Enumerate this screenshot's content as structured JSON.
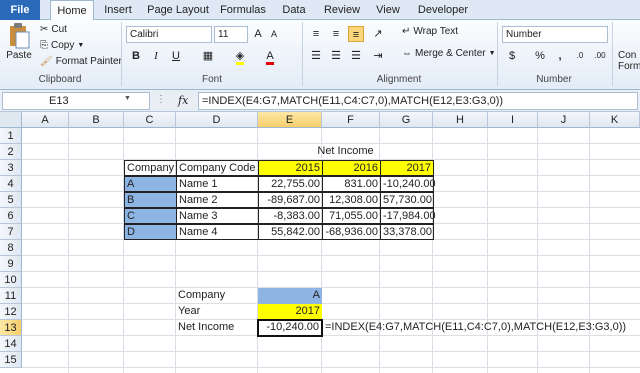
{
  "ribbon": {
    "tabs": [
      "File",
      "Home",
      "Insert",
      "Page Layout",
      "Formulas",
      "Data",
      "Review",
      "View",
      "Developer"
    ],
    "clipboard": {
      "paste": "Paste",
      "cut": "Cut",
      "copy": "Copy",
      "format_painter": "Format Painter",
      "group": "Clipboard"
    },
    "font": {
      "name": "Calibri",
      "size": "11",
      "bold": "B",
      "italic": "I",
      "underline": "U",
      "group": "Font"
    },
    "alignment": {
      "wrap": "Wrap Text",
      "merge": "Merge & Center",
      "group": "Alignment"
    },
    "number": {
      "format": "Number",
      "percent": "%",
      "comma": ",",
      "group": "Number"
    },
    "styles": {
      "cond": "Con",
      "form": "Form"
    }
  },
  "formula_bar": {
    "name_box": "E13",
    "fx": "fx",
    "formula": "=INDEX(E4:G7,MATCH(E11,C4:C7,0),MATCH(E12,E3:G3,0))"
  },
  "grid": {
    "columns": [
      "A",
      "B",
      "C",
      "D",
      "E",
      "F",
      "G",
      "H",
      "I",
      "J",
      "K"
    ],
    "rows": [
      "1",
      "2",
      "3",
      "4",
      "5",
      "6",
      "7",
      "8",
      "9",
      "10",
      "11",
      "12",
      "13",
      "14",
      "15"
    ],
    "title": "Net Income",
    "header": {
      "company": "Company",
      "code": "Company Code",
      "y2015": "2015",
      "y2016": "2016",
      "y2017": "2017"
    },
    "data": [
      {
        "company": "A",
        "code": "Name 1",
        "v2015": "22,755.00",
        "v2016": "831.00",
        "v2017": "-10,240.00"
      },
      {
        "company": "B",
        "code": "Name 2",
        "v2015": "-89,687.00",
        "v2016": "12,308.00",
        "v2017": "57,730.00"
      },
      {
        "company": "C",
        "code": "Name 3",
        "v2015": "-8,383.00",
        "v2016": "71,055.00",
        "v2017": "-17,984.00"
      },
      {
        "company": "D",
        "code": "Name 4",
        "v2015": "55,842.00",
        "v2016": "-68,936.00",
        "v2017": "33,378.00"
      }
    ],
    "lookup": {
      "company_label": "Company",
      "company_value": "A",
      "year_label": "Year",
      "year_value": "2017",
      "result_label": "Net Income",
      "result_value": "-10,240.00",
      "formula_text": "=INDEX(E4:G7,MATCH(E11,C4:C7,0),MATCH(E12,E3:G3,0))"
    }
  }
}
